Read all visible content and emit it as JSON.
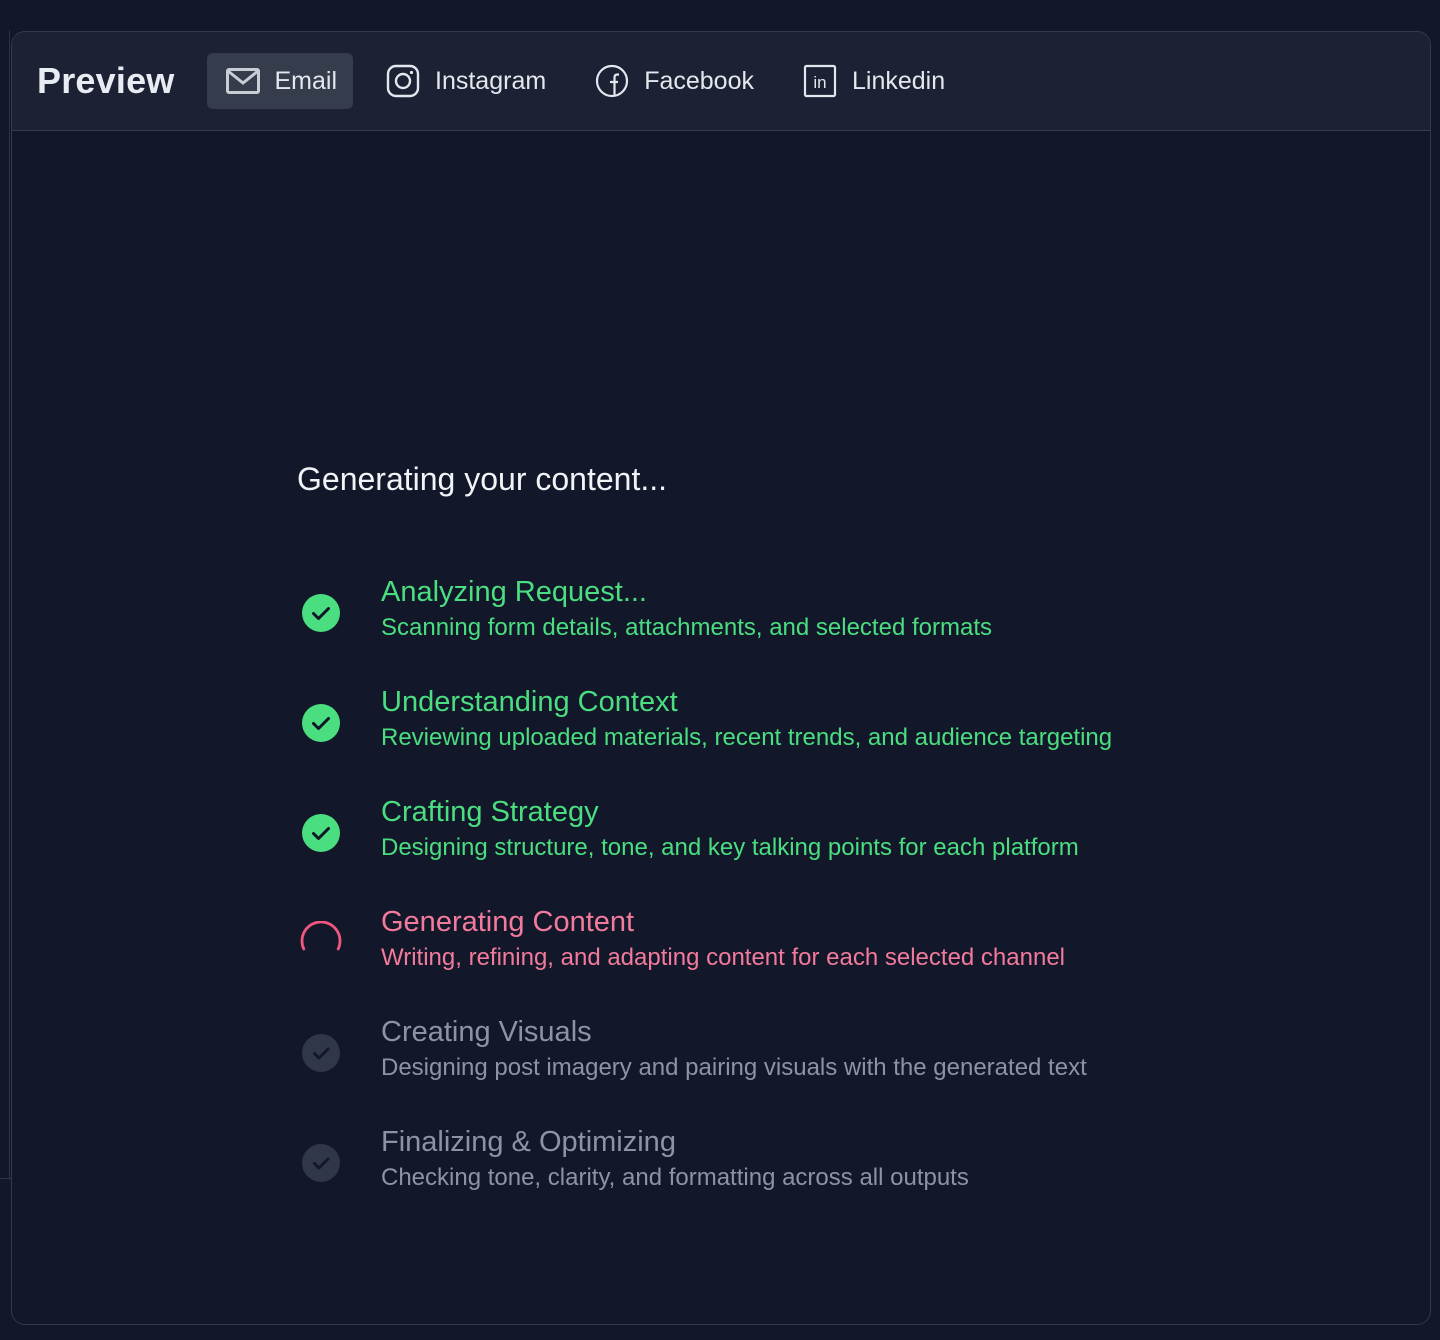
{
  "header": {
    "title": "Preview",
    "tabs": [
      {
        "label": "Email",
        "icon": "mail-icon",
        "active": true
      },
      {
        "label": "Instagram",
        "icon": "instagram-icon",
        "active": false
      },
      {
        "label": "Facebook",
        "icon": "facebook-icon",
        "active": false
      },
      {
        "label": "Linkedin",
        "icon": "linkedin-icon",
        "active": false
      }
    ]
  },
  "progress": {
    "heading": "Generating your content...",
    "steps": [
      {
        "title": "Analyzing Request...",
        "description": "Scanning form details, attachments, and selected formats",
        "status": "done"
      },
      {
        "title": "Understanding Context",
        "description": "Reviewing uploaded materials, recent trends, and audience targeting",
        "status": "done"
      },
      {
        "title": "Crafting Strategy",
        "description": "Designing structure, tone, and key talking points for each platform",
        "status": "done"
      },
      {
        "title": "Generating Content",
        "description": "Writing, refining, and adapting content for each selected channel",
        "status": "in-progress"
      },
      {
        "title": "Creating Visuals",
        "description": "Designing post imagery and pairing visuals with the generated text",
        "status": "pending"
      },
      {
        "title": "Finalizing & Optimizing",
        "description": "Checking tone, clarity, and formatting across all outputs",
        "status": "pending"
      }
    ]
  },
  "colors": {
    "done": "#4ade80",
    "in_progress": "#f27a9c",
    "pending": "#8d93a1",
    "background": "#121829",
    "header_background": "#1c2233"
  }
}
